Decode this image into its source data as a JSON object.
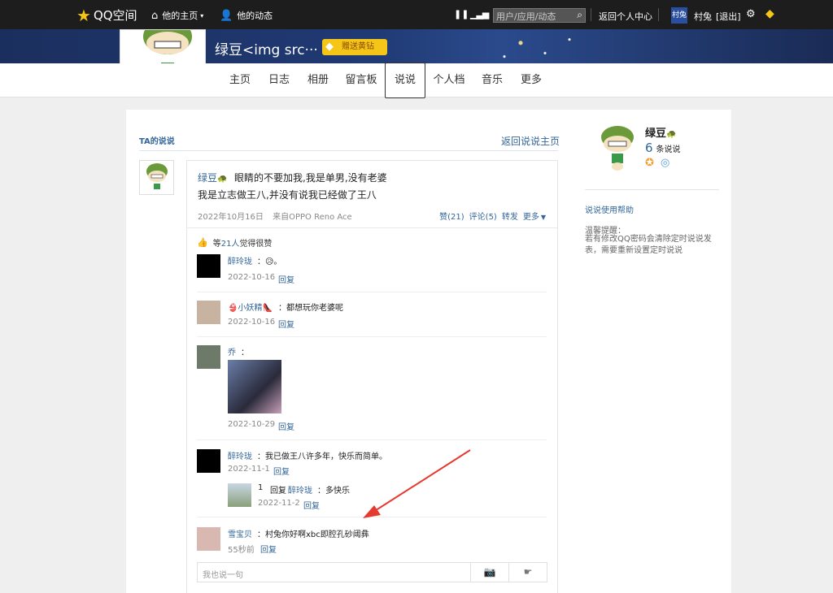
{
  "topbar": {
    "logo": "QQ空间",
    "his_home": "他的主页",
    "his_news": "他的动态",
    "search_placeholder": "用户/应用/动态",
    "back_center": "返回个人中心",
    "avatar_text": "村兔",
    "user_name": "村兔",
    "logout": "[退出]"
  },
  "banner": {
    "owner_name": "绿豆<img src···",
    "vip_label": "赠送黄钻"
  },
  "tabs": [
    "主页",
    "日志",
    "相册",
    "留言板",
    "说说",
    "个人档",
    "音乐",
    "更多"
  ],
  "active_tab": "说说",
  "main": {
    "section_title": "TA的说说",
    "back_link": "返回说说主页"
  },
  "post": {
    "author": "绿豆",
    "line1": "眼睛的不要加我,我是单男,没有老婆",
    "line2": "我是立志做王八,并没有说我已经做了王八",
    "date": "2022年10月16日",
    "source": "来自OPPO Reno Ace",
    "like_label": "赞(21)",
    "comment_label": "评论(5)",
    "forward_label": "转发",
    "more_label": "更多",
    "likes_prefix": "等",
    "likes_count": "21人",
    "likes_suffix": "觉得很赞"
  },
  "comments": [
    {
      "name": "醉玲珑",
      "text": "：😥。",
      "date": "2022-10-16",
      "reply": "回复"
    },
    {
      "name": "👙小妖精👠",
      "text": "：都想玩你老婆呢",
      "date": "2022-10-16",
      "reply": "回复"
    },
    {
      "name": "乔",
      "text": "：",
      "date": "2022-10-29",
      "reply": "回复"
    },
    {
      "name": "醉玲珑",
      "text": "：我已做王八许多年，快乐而简单。",
      "date": "2022-11-1",
      "reply": "回复",
      "subreply": {
        "from": "1",
        "verb": "回复",
        "to": "醉玲珑",
        "text": "：多快乐",
        "date": "2022-11-2",
        "reply": "回复"
      }
    },
    {
      "name": "雪宝贝",
      "text": "：村兔你好啊xbc即腔孔砂阈彝",
      "date": "55秒前",
      "reply": "回复"
    }
  ],
  "reply_placeholder": "我也说一句",
  "sidebar": {
    "name": "绿豆",
    "count": "6",
    "count_label": "条说说",
    "help": "说说使用帮助",
    "tip_title": "温馨提醒：",
    "tip_text": "若有修改QQ密码会清除定时说说发表，需要重新设置定时说说"
  },
  "colors": {
    "link": "#336699",
    "topbar": "#1d1d1d",
    "banner": "#203a74",
    "vip": "#f5c518",
    "arrow": "#e53a2f"
  }
}
